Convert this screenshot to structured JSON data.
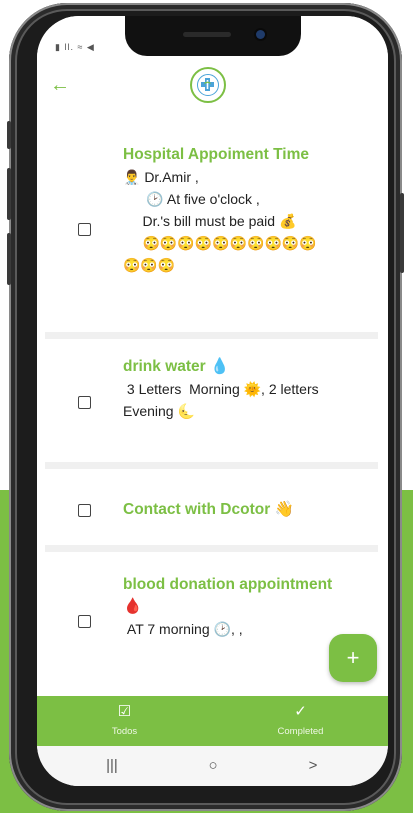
{
  "app": {
    "status_icons": "▮ ll. ≈ ◀"
  },
  "header": {
    "back_icon": "←",
    "logo_icon": "medical-cross-icon",
    "accent_color": "#7cbf44"
  },
  "todos": [
    {
      "title": "Hospital Appoiment Time",
      "description": "👨‍⚕️ Dr.Amir ,\n      🕑 At five o'clock ,\n     Dr.'s bill must be paid 💰\n     😳😳😳😳😳😳😳😳😳😳\n😳😳😳",
      "checked": false
    },
    {
      "title": "drink water 💧",
      "description": " 3 Letters  Morning 🌞, 2 letters\nEvening 🌜",
      "checked": false
    },
    {
      "title": "Contact with Dcotor 👋",
      "description": "",
      "checked": false
    },
    {
      "title": "blood donation appointment\n🩸",
      "description": " AT 7 morning 🕑, ,",
      "checked": false
    }
  ],
  "fab": {
    "label": "+"
  },
  "bottom_nav": {
    "items": [
      {
        "label": "Todos",
        "icon": "☑"
      },
      {
        "label": "Completed",
        "icon": "✓"
      }
    ]
  },
  "system_nav": {
    "recents": "|||",
    "home": "○",
    "back": ">"
  }
}
